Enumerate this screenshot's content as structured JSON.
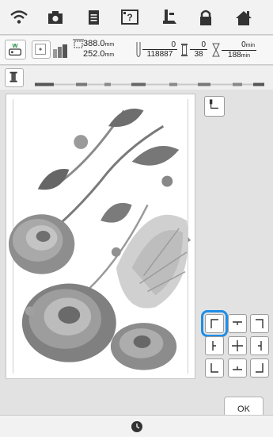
{
  "topbar": {
    "icons": [
      "wifi-icon",
      "camera-icon",
      "document-icon",
      "help-icon",
      "presser-foot-icon",
      "lock-icon",
      "home-icon"
    ]
  },
  "info": {
    "width_value": "388.0",
    "height_value": "252.0",
    "size_unit": "mm",
    "stitch_count": "0",
    "stitch_total": "118887",
    "color_index": "0",
    "color_total": "38",
    "time_elapsed": "0",
    "time_total": "188",
    "time_unit": "min"
  },
  "buttons": {
    "ok": "OK"
  },
  "position_grid": [
    "top-left",
    "top-center",
    "top-right",
    "middle-left",
    "center",
    "middle-right",
    "bottom-left",
    "bottom-center",
    "bottom-right"
  ],
  "selected_position": "top-left",
  "colors": {
    "accent": "#1f8ee6"
  }
}
